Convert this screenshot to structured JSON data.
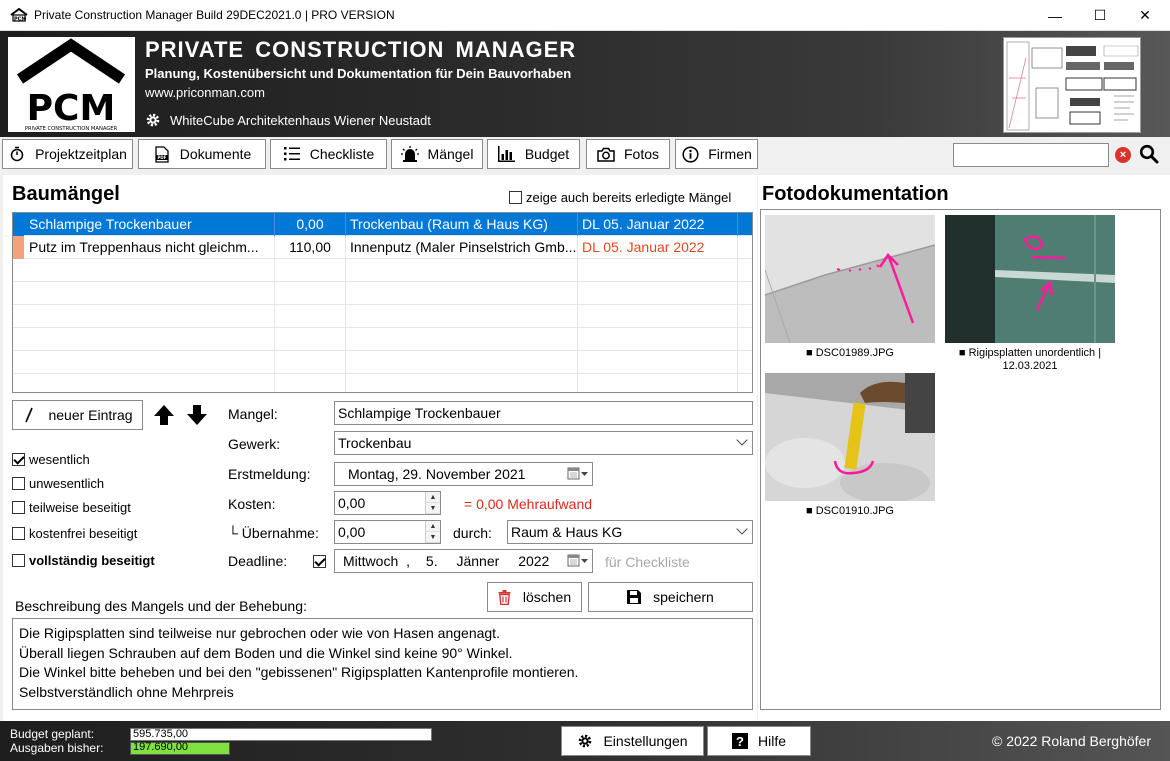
{
  "window": {
    "title": "Private Construction Manager Build 29DEC2021.0 | PRO VERSION",
    "controls": {
      "minimize": "—",
      "maximize": "☐",
      "close": "✕"
    }
  },
  "header": {
    "logo_text": "PCM",
    "logo_subtext": "PRIVATE CONSTRUCTION MANAGER",
    "app_name": "PRIVATE  CONSTRUCTION  MANAGER",
    "tagline": "Planung, Kostenübersicht und Dokumentation für Dein Bauvorhaben",
    "url": "www.priconman.com",
    "project": "WhiteCube Architektenhaus Wiener Neustadt"
  },
  "toolbar": {
    "buttons": [
      {
        "label": "Projektzeitplan",
        "icon": "stopwatch-icon"
      },
      {
        "label": "Dokumente",
        "icon": "pdf-icon"
      },
      {
        "label": "Checkliste",
        "icon": "list-icon"
      },
      {
        "label": "Mängel",
        "icon": "alarm-icon"
      },
      {
        "label": "Budget",
        "icon": "bar-chart-icon"
      },
      {
        "label": "Fotos",
        "icon": "camera-icon"
      },
      {
        "label": "Firmen",
        "icon": "info-icon"
      }
    ],
    "search_value": ""
  },
  "defects": {
    "title": "Baumängel",
    "show_completed_label": "zeige auch bereits erledigte Mängel",
    "show_completed_checked": false,
    "rows": [
      {
        "name": "Schlampige Trockenbauer",
        "cost": "0,00",
        "trade": "Trockenbau (Raum & Haus KG)",
        "deadline": "DL 05. Januar 2022",
        "selected": true,
        "marker_color": "#0078d7"
      },
      {
        "name": "Putz im Treppenhaus nicht gleichm...",
        "cost": "110,00",
        "trade": "Innenputz (Maler Pinselstrich Gmb...",
        "deadline": "DL 05. Januar 2022",
        "selected": false,
        "marker_color": "#f4a27c"
      }
    ],
    "new_entry_label": "neuer Eintrag",
    "checkboxes": [
      {
        "label": "wesentlich",
        "checked": true,
        "bold": false
      },
      {
        "label": "unwesentlich",
        "checked": false,
        "bold": false
      },
      {
        "label": "teilweise beseitigt",
        "checked": false,
        "bold": false
      },
      {
        "label": "kostenfrei beseitigt",
        "checked": false,
        "bold": false
      },
      {
        "label": "vollständig beseitigt",
        "checked": false,
        "bold": true
      }
    ],
    "form": {
      "mangel_label": "Mangel:",
      "mangel_value": "Schlampige Trockenbauer",
      "gewerk_label": "Gewerk:",
      "gewerk_value": "Trockenbau",
      "erst_label": "Erstmeldung:",
      "erst_weekday": "Montag",
      "erst_date": ", 29. November 2021",
      "kosten_label": "Kosten:",
      "kosten_value": "0,00",
      "mehraufwand": "= 0,00 Mehraufwand",
      "uebernahme_label": "└ Übernahme:",
      "uebernahme_value": "0,00",
      "durch_label": "durch:",
      "durch_value": "Raum & Haus KG",
      "deadline_label": "Deadline:",
      "deadline_checked": true,
      "deadline_weekday": "Mittwoch",
      "deadline_sep": ",",
      "deadline_day": "5.",
      "deadline_month": "Jänner",
      "deadline_year": "2022",
      "checklist_hint": "für Checkliste"
    },
    "delete_label": "löschen",
    "save_label": "speichern",
    "description_label": "Beschreibung des Mangels und der Behebung:",
    "description_lines": [
      "Die Rigipsplatten sind teilweise nur gebrochen oder wie von Hasen angenagt.",
      "Überall liegen Schrauben auf dem Boden und die Winkel sind keine 90° Winkel.",
      "Die Winkel bitte beheben und bei den \"gebissenen\" Rigipsplatten Kantenprofile montieren.",
      "Selbstverständlich ohne Mehrpreis"
    ]
  },
  "photos": {
    "title": "Fotodokumentation",
    "items": [
      {
        "caption": "■ DSC01989.JPG"
      },
      {
        "caption": "■ Rigipsplatten unordentlich |",
        "caption2": "12.03.2021"
      },
      {
        "caption": "■ DSC01910.JPG"
      }
    ]
  },
  "status": {
    "budget_label": "Budget  geplant:",
    "budget_value": "595.735,00",
    "spent_label": "Ausgaben bisher:",
    "spent_value": "197.690,00",
    "spent_fraction": 0.332,
    "settings_label": "Einstellungen",
    "help_label": "Hilfe",
    "copyright": "© 2022 Roland Berghöfer"
  }
}
